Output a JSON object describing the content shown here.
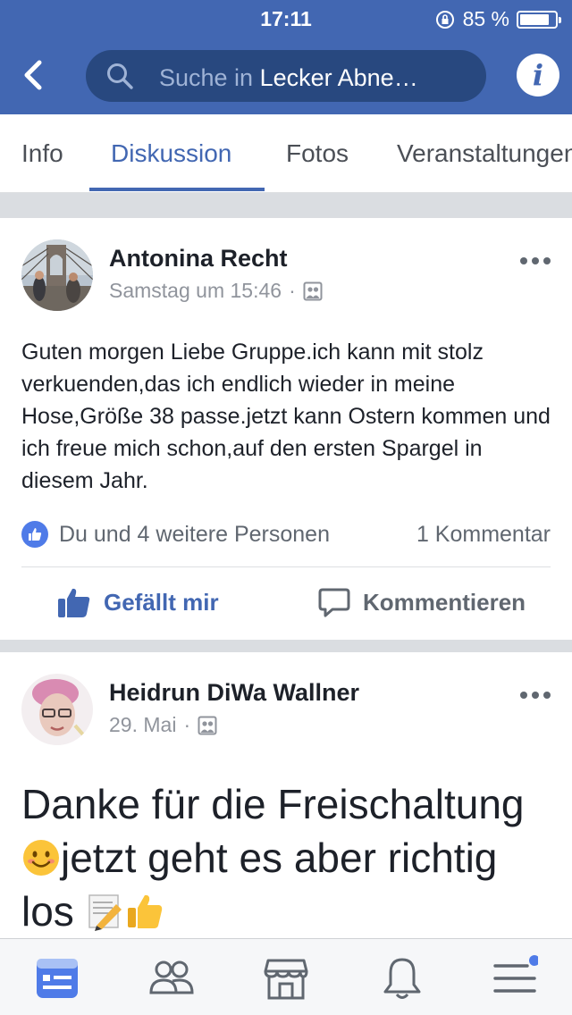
{
  "status_bar": {
    "time": "17:11",
    "battery": "85 %",
    "battery_level": 0.85
  },
  "search": {
    "placeholder_prefix": "Suche in",
    "group_name": "Lecker Abne…"
  },
  "tabs": [
    {
      "label": "Info",
      "active": false
    },
    {
      "label": "Diskussion",
      "active": true
    },
    {
      "label": "Fotos",
      "active": false
    },
    {
      "label": "Veranstaltungen",
      "active": false
    }
  ],
  "posts": [
    {
      "author": "Antonina Recht",
      "time": "Samstag um 15:46",
      "separator": "·",
      "audience_icon": "group-audience-icon",
      "text": "Guten morgen Liebe Gruppe.ich kann mit stolz verkuenden,das ich endlich wieder in meine Hose,Größe 38 passe.jetzt kann Ostern kommen und ich freue mich schon,auf den ersten Spargel in diesem Jahr.",
      "reactions": "Du und 4 weitere Personen",
      "comments": "1 Kommentar",
      "like_label": "Gefällt mir",
      "comment_label": "Kommentieren"
    },
    {
      "author": "Heidrun DiWa Wallner",
      "time": "29. Mai",
      "separator": "·",
      "audience_icon": "group-audience-icon",
      "text_part1": "Danke für die Freischaltung ",
      "text_part2": "jetzt geht es aber richtig los ",
      "emojis": [
        "smiling-face-emoji",
        "memo-pencil-emoji",
        "thumbs-up-emoji"
      ]
    }
  ],
  "bottom_nav": [
    "news-feed-icon",
    "groups-icon",
    "marketplace-icon",
    "notifications-icon",
    "menu-icon"
  ],
  "colors": {
    "brand": "#4267b2",
    "search_bg": "#28487f",
    "like": "#4f7be8"
  }
}
